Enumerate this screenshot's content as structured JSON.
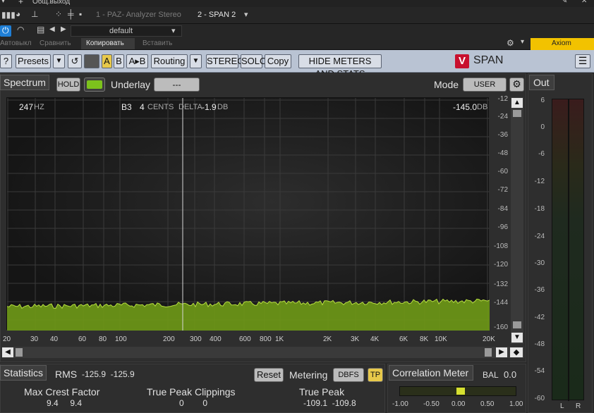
{
  "host": {
    "title": "Общ.выход",
    "plugin_tab_1": "1 - PAZ- Analyzer Stereo",
    "plugin_tab_2": "2 - SPAN 2",
    "preset_name": "default",
    "autooff_label": "Автовыкл",
    "compare_label": "Сравнить",
    "copy_label": "Копировать",
    "paste_label": "Вставить",
    "device_label": "Axiom",
    "accent_yellow": "#f2c200"
  },
  "toolbar": {
    "help_label": "?",
    "presets_label": "Presets",
    "a_label": "A",
    "b_label": "B",
    "ab_label": "A▸B",
    "routing_label": "Routing",
    "stereo_label": "STEREO",
    "solo_label": "SOLO",
    "copy_label": "Copy",
    "hide_label": "HIDE METERS AND STATS",
    "brand_label": "SPAN"
  },
  "spectrum": {
    "title": "Spectrum",
    "hold_label": "HOLD",
    "underlay_label": "Underlay",
    "underlay_value": "---",
    "mode_label": "Mode",
    "mode_value": "USER",
    "freq_readout": "247",
    "freq_unit": "HZ",
    "note_readout": "B3",
    "cents_readout": "4",
    "cents_unit": "CENTS",
    "delta_label": "DELTA",
    "delta_value": "-1.9",
    "delta_unit": "DB",
    "level_readout": "-145.0",
    "level_unit": "DB",
    "y_ticks": [
      "-12",
      "-24",
      "-36",
      "-48",
      "-60",
      "-72",
      "-84",
      "-96",
      "-108",
      "-120",
      "-132",
      "-144",
      "-160"
    ],
    "x_ticks": [
      "20",
      "30",
      "40",
      "60",
      "80",
      "100",
      "200",
      "300",
      "400",
      "600",
      "800",
      "1K",
      "2K",
      "3K",
      "4K",
      "6K",
      "8K",
      "10K",
      "20K"
    ],
    "fill_color": "#7ca81c"
  },
  "out": {
    "title": "Out",
    "ticks": [
      "6",
      "0",
      "-6",
      "-12",
      "-18",
      "-24",
      "-30",
      "-36",
      "-42",
      "-48",
      "-54",
      "-60"
    ],
    "l_label": "L",
    "r_label": "R"
  },
  "stats": {
    "title": "Statistics",
    "rms_label": "RMS",
    "rms_values": "-125.9  -125.9",
    "reset_label": "Reset",
    "metering_label": "Metering",
    "dbfs_label": "DBFS",
    "tp_label": "TP",
    "crest_label": "Max Crest Factor",
    "crest_values": "9.4     9.4",
    "clip_label": "True Peak Clippings",
    "clip_values": "0        0",
    "tpeak_label": "True Peak",
    "tpeak_values": "-109.1  -109.8"
  },
  "corr": {
    "title": "Correlation Meter",
    "bal_label": "BAL",
    "bal_value": "0.0",
    "ticks": [
      "-1.00",
      "-0.50",
      "0.00",
      "0.50",
      "1.00"
    ]
  }
}
